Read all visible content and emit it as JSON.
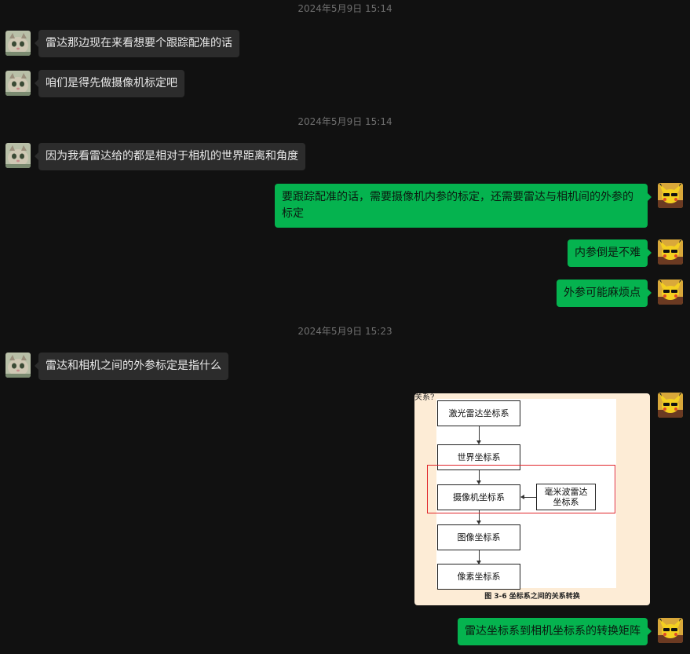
{
  "chat": {
    "timestamps": [
      "2024年5月9日 15:14",
      "2024年5月9日 15:14",
      "2024年5月9日 15:23"
    ],
    "messages": [
      {
        "sender": "other",
        "text": "雷达那边现在来看想要个跟踪配准的话"
      },
      {
        "sender": "other",
        "text": "咱们是得先做摄像机标定吧"
      },
      {
        "sender": "other",
        "text": "因为我看雷达给的都是相对于相机的世界距离和角度"
      },
      {
        "sender": "me",
        "text": "要跟踪配准的话，需要摄像机内参的标定，还需要雷达与相机间的外参的标定"
      },
      {
        "sender": "me",
        "text": "内参倒是不难"
      },
      {
        "sender": "me",
        "text": "外参可能麻烦点"
      },
      {
        "sender": "other",
        "text": "雷达和相机之间的外参标定是指什么"
      },
      {
        "sender": "me",
        "text": "雷达坐标系到相机坐标系的转换矩阵"
      }
    ],
    "image_message": {
      "cut_text": "关系?",
      "boxes": [
        "激光雷达坐标系",
        "世界坐标系",
        "摄像机坐标系",
        "毫米波雷达坐标系",
        "图像坐标系",
        "像素坐标系"
      ],
      "caption": "图 3-6 坐标系之间的关系转换",
      "highlight_color": "#e0262a"
    }
  },
  "colors": {
    "background": "#111111",
    "incoming_bubble": "#2c2c2c",
    "outgoing_bubble": "#05b34f"
  }
}
